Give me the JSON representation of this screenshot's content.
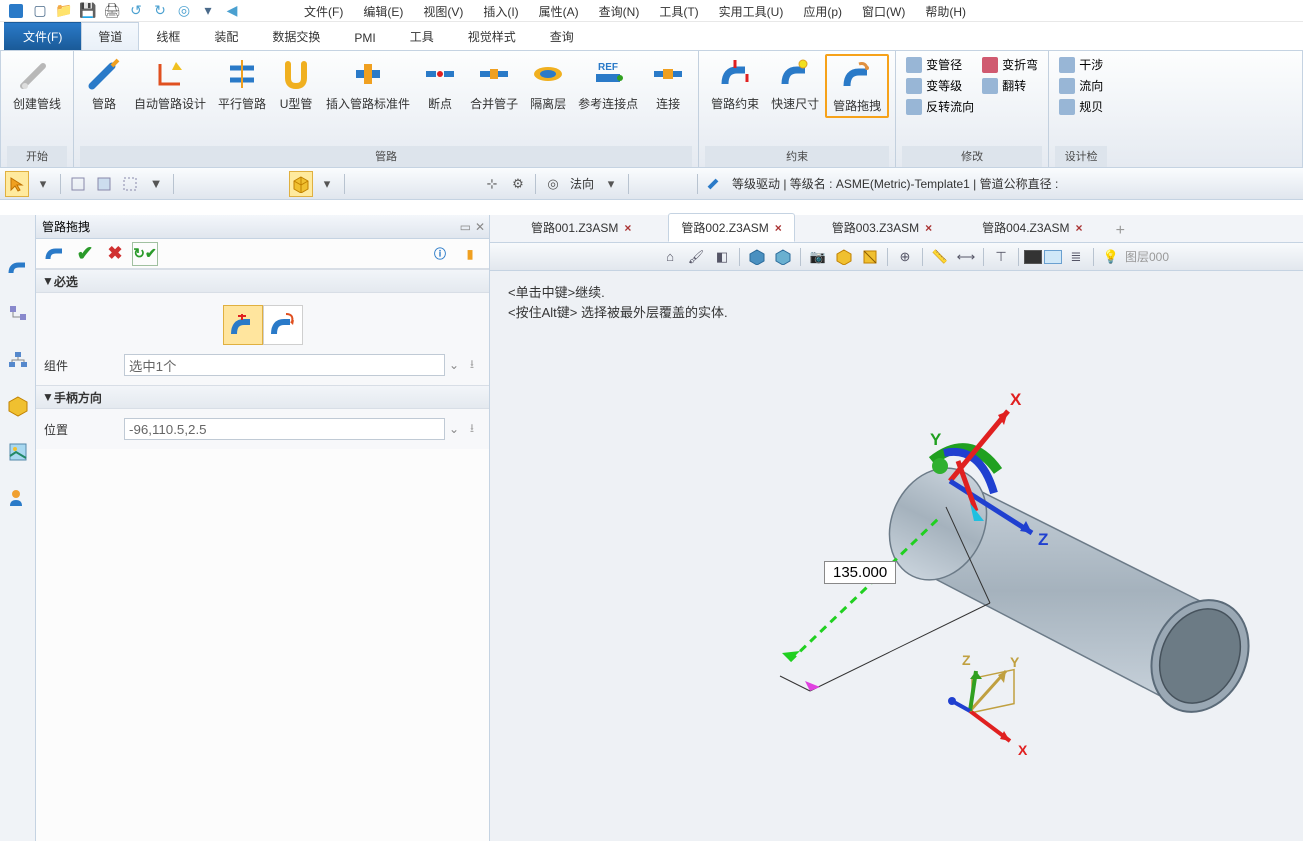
{
  "menu": {
    "file": "文件(F)",
    "edit": "编辑(E)",
    "view": "视图(V)",
    "insert": "插入(I)",
    "attr": "属性(A)",
    "query": "查询(N)",
    "tool": "工具(T)",
    "util": "实用工具(U)",
    "app": "应用(p)",
    "window": "窗口(W)",
    "help": "帮助(H)"
  },
  "tabs": {
    "file": "文件(F)",
    "pipe": "管道",
    "wire": "线框",
    "asm": "装配",
    "exchange": "数据交换",
    "pmi": "PMI",
    "tool": "工具",
    "style": "视觉样式",
    "query": "查询"
  },
  "ribbon": {
    "groups": {
      "start": "开始",
      "route": "管路",
      "constraint": "约束",
      "modify": "修改",
      "check": "设计检"
    },
    "create_pipe": "创建管线",
    "route_path": "管路",
    "auto_route": "自动管路设计",
    "parallel": "平行管路",
    "u_pipe": "U型管",
    "insert_std": "插入管路标准件",
    "breakpoint": "断点",
    "merge_tube": "合并管子",
    "isolation": "隔离层",
    "ref_point": "参考连接点",
    "connect": "连接",
    "route_cons": "管路约束",
    "quick_dim": "快速尺寸",
    "route_drag": "管路拖拽",
    "chg_diameter": "变管径",
    "chg_bend": "变折弯",
    "chg_level": "变等级",
    "flip": "翻转",
    "reverse_flow": "反转流向",
    "interfere": "干涉",
    "flow": "流向",
    "rule": "规贝"
  },
  "toolbar2": {
    "normal": "法向",
    "status_prefix": "等级驱动 | 等级名 : ",
    "template": "ASME(Metric)-Template1",
    "status_suffix": " | 管道公称直径 :"
  },
  "cmd_panel": {
    "title": "管路拖拽",
    "required": "必选",
    "handle_dir": "手柄方向",
    "component": "组件",
    "component_value": "选中1个",
    "position": "位置",
    "position_value": "-96,110.5,2.5"
  },
  "doc_tabs": {
    "t1": "管路001.Z3ASM",
    "t2": "管路002.Z3ASM",
    "t3": "管路003.Z3ASM",
    "t4": "管路004.Z3ASM"
  },
  "viewport": {
    "hint1": "<单击中键>继续.",
    "hint2": "<按住Alt键> 选择被最外层覆盖的实体.",
    "dim_value": "135.000",
    "layer": "图层000",
    "axes": {
      "x": "X",
      "y": "Y",
      "z": "Z"
    },
    "colors": {
      "x_axis": "#e02020",
      "y_axis": "#30a020",
      "z_axis": "#2040d0",
      "dim_arrow": "#e040e0",
      "drag_line": "#20d020",
      "pipe_fill": "#b5c2cc",
      "pipe_edge": "#6c7b88"
    }
  }
}
